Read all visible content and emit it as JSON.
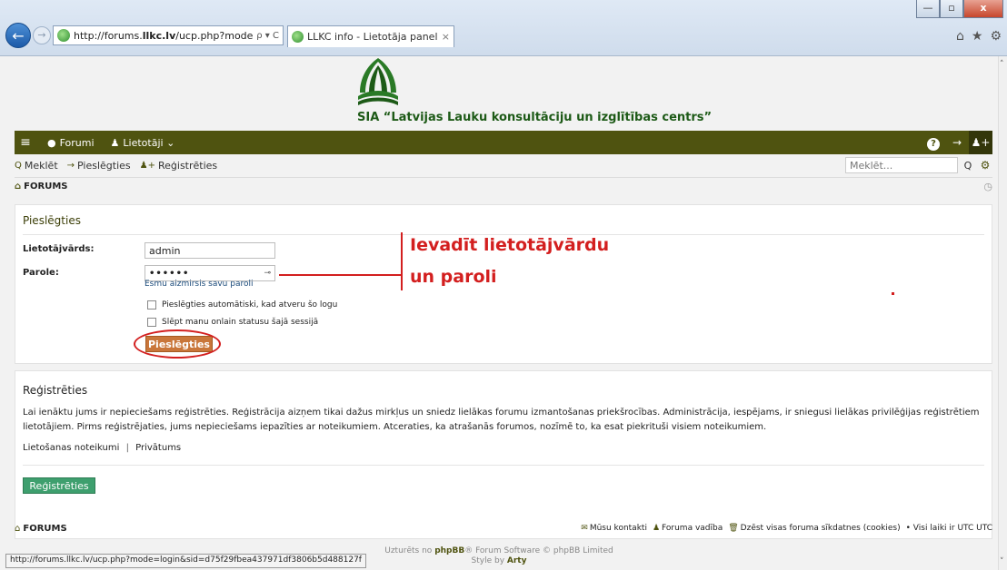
{
  "browser": {
    "window_controls": {
      "minimize": "—",
      "maximize": "▫",
      "close": "x"
    },
    "address": {
      "url_prefix": "http://forums.",
      "url_domain": "llkc.lv",
      "url_rest": "/ucp.php?mode=login",
      "tools": "ρ ▾ C"
    },
    "tab": {
      "title": "LLKC info - Lietotāja paneli...",
      "close": "×"
    },
    "icons": {
      "home": "⌂",
      "star": "★",
      "gear": "⚙"
    },
    "status_url": "http://forums.llkc.lv/ucp.php?mode=login&sid=d75f29fbea437971df3806b5d488127f"
  },
  "site": {
    "org_name": "SIA “Latvijas Lauku konsultāciju un izglītības centrs”",
    "brand_color": "#4f5310"
  },
  "navbar": {
    "menu_icon": "≡",
    "forums_icon": "●",
    "forums": "Forumi",
    "users_icon": "♟",
    "users": "Lietotāji ⌄",
    "help_icon": "?",
    "login_icon": "→",
    "register_icon": "♟+"
  },
  "subnav": {
    "search_icon": "Q",
    "search": "Meklēt",
    "login_icon": "→",
    "login": "Pieslēgties",
    "register_icon": "♟+",
    "register": "Reģistrēties",
    "search_placeholder": "Meklēt...",
    "search_btn": "Q",
    "advanced_icon": "⚙"
  },
  "breadcrumb": {
    "home_icon": "⌂",
    "label": "FORUMS",
    "clock_icon": "◷"
  },
  "login": {
    "title": "Pieslēgties",
    "username_label": "Lietotājvārds:",
    "username_value": "admin",
    "password_label": "Parole:",
    "password_value": "••••••",
    "password_eye": "⊸",
    "forgot": "Esmu aizmirsis savu paroli",
    "remember": "Pieslēgties automātiski, kad atveru šo logu",
    "hide_online": "Slēpt manu onlain statusu šajā sessijā",
    "submit": "Pieslēgties"
  },
  "annotation": {
    "line1": "Ievadīt lietotājvārdu",
    "line2": "un paroli",
    "color": "#d31f1f"
  },
  "register": {
    "title": "Reģistrēties",
    "text": "Lai ienāktu jums ir nepieciešams reģistrēties. Reģistrācija aizņem tikai dažus mirkļus un sniedz lielākas forumu izmantošanas priekšrocības. Administrācija, iespējams, ir sniegusi lielākas privilēģijas reģistrētiem lietotājiem. Pirms reģistrējaties, jums nepieciešams iepazīties ar noteikumiem. Atceraties, ka atrašanās forumos, nozīmē to, ka esat piekrituši visiem noteikumiem.",
    "terms": "Lietošanas noteikumi",
    "separator": "|",
    "privacy": "Privātums",
    "button": "Reģistrēties",
    "button_color": "#3e9f6e"
  },
  "footer": {
    "home_icon": "⌂",
    "title": "FORUMS",
    "contact_icon": "✉",
    "contact": "Mūsu kontakti",
    "team_icon": "♟",
    "team": "Foruma vadība",
    "cookies_icon": "🗑",
    "cookies": "Dzēst visas foruma sīkdatnes (cookies)",
    "timezone": "• Visi laiki ir UTC UTC"
  },
  "credits": {
    "line1_prefix": "Uzturēts no",
    "line1_brand": "phpBB",
    "line1_rest": "® Forum Software © phpBB Limited",
    "line2_prefix": "Style by",
    "line2_author": "Arty"
  }
}
